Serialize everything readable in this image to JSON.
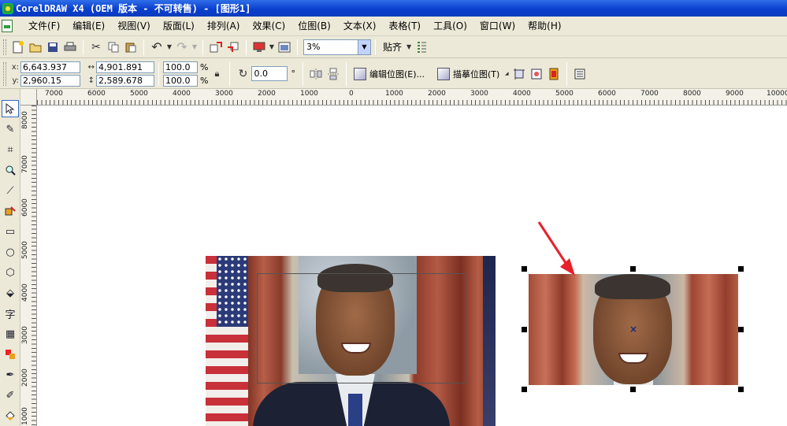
{
  "window": {
    "title": "CorelDRAW X4 (OEM 版本 - 不可转售) - [图形1]"
  },
  "menu": [
    "文件(F)",
    "编辑(E)",
    "视图(V)",
    "版面(L)",
    "排列(A)",
    "效果(C)",
    "位图(B)",
    "文本(X)",
    "表格(T)",
    "工具(O)",
    "窗口(W)",
    "帮助(H)"
  ],
  "toolbar": {
    "zoom_value": "3%",
    "snap_label": "贴齐"
  },
  "propbar": {
    "x_label": "x:",
    "y_label": "y:",
    "x_value": "6,643.937 mm",
    "y_value": "2,960.15 mm",
    "width_value": "4,901.891 mm",
    "height_value": "2,589.678 mm",
    "scale_w": "100.0",
    "scale_h": "100.0",
    "pct": "%",
    "angle_value": "0.0",
    "degree": "°",
    "edit_bitmap": "编辑位图(E)...",
    "trace_bitmap": "描摹位图(T)"
  },
  "ruler": {
    "h_labels": [
      "7000",
      "6000",
      "5000",
      "4000",
      "3000",
      "2000",
      "1000",
      "0",
      "1000",
      "2000",
      "3000",
      "4000",
      "5000",
      "6000",
      "7000",
      "8000",
      "9000",
      "10000"
    ],
    "v_labels": [
      "8000",
      "7000",
      "6000",
      "5000",
      "4000",
      "3000",
      "2000",
      "1000"
    ]
  },
  "icons": {
    "toolbox": [
      "pick-icon",
      "shape-icon",
      "crop-icon",
      "zoom-icon",
      "freehand-icon",
      "smart-fill-icon",
      "rectangle-icon",
      "ellipse-icon",
      "polygon-icon",
      "basic-shapes-icon",
      "text-icon",
      "table-icon",
      "interactive-blend-icon",
      "eyedropper-icon",
      "outline-icon",
      "fill-icon"
    ],
    "text_tool_glyph": "字"
  },
  "colors": {
    "titlebar": "#0a3fcf",
    "arrow": "#e8202a",
    "selection_handle": "#000000"
  }
}
